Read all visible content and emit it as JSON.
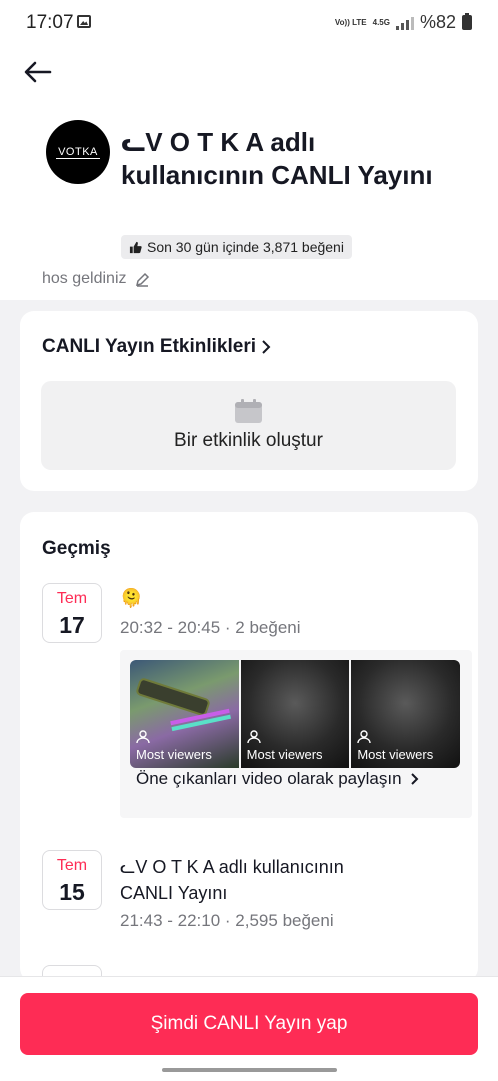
{
  "status": {
    "time": "17:07",
    "network": "4.5G",
    "volte": "Vo)) LTE",
    "battery": "%82"
  },
  "header": {
    "avatar_text": "VOTKA",
    "title": "ᓚV O T K A adlı kullanıcının CANLI Yayını",
    "likes_badge": "Son 30 gün içinde 3,871 beğeni",
    "bio": "hos geldiniz"
  },
  "events": {
    "title": "CANLI Yayın Etkinlikleri",
    "create_label": "Bir etkinlik oluştur"
  },
  "history": {
    "title": "Geçmiş",
    "entries": [
      {
        "month": "Tem",
        "day": "17",
        "title": "🫠",
        "meta": "20:32 - 20:45 · 2 beğeni"
      },
      {
        "month": "Tem",
        "day": "15",
        "title_line1": "ᓚV O T K A  adlı kullanıcının",
        "title_line2": "CANLI Yayını",
        "meta": "21:43 - 22:10 · 2,595 beğeni"
      }
    ],
    "highlights": {
      "thumb_labels": [
        "Most viewers",
        "Most viewers",
        "Most viewers"
      ],
      "share_label": "Öne çıkanları video olarak paylaşın"
    }
  },
  "go_live_label": "Şimdi CANLI Yayın yap"
}
